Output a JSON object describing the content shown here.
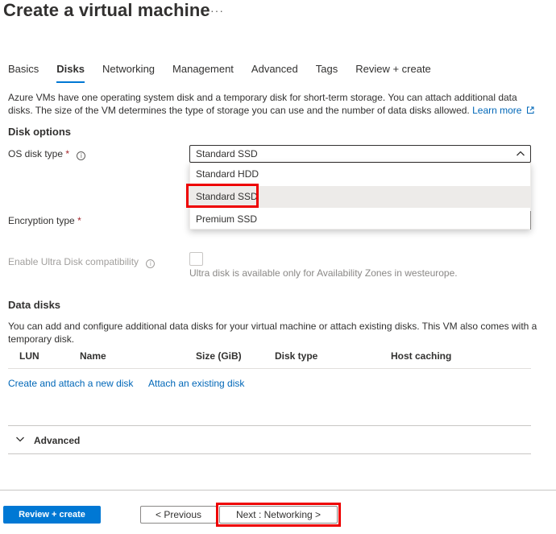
{
  "header": {
    "title": "Create a virtual machine",
    "more": "···"
  },
  "tabs": [
    {
      "label": "Basics"
    },
    {
      "label": "Disks",
      "active": true
    },
    {
      "label": "Networking"
    },
    {
      "label": "Management"
    },
    {
      "label": "Advanced"
    },
    {
      "label": "Tags"
    },
    {
      "label": "Review + create"
    }
  ],
  "intro": {
    "text": "Azure VMs have one operating system disk and a temporary disk for short-term storage. You can attach additional data disks. The size of the VM determines the type of storage you can use and the number of data disks allowed.",
    "learn_more": "Learn more"
  },
  "disk_options": {
    "heading": "Disk options",
    "os_disk_type": {
      "label": "OS disk type",
      "required": "*",
      "info": "i",
      "selected": "Standard SSD",
      "options": [
        "Standard HDD",
        "Standard SSD",
        "Premium SSD"
      ],
      "hovered_option": "Standard SSD"
    },
    "encryption_type": {
      "label": "Encryption type",
      "required": "*"
    },
    "ultra_disk": {
      "label": "Enable Ultra Disk compatibility",
      "info": "i",
      "note": "Ultra disk is available only for Availability Zones in westeurope.",
      "checked": false
    }
  },
  "data_disks": {
    "heading": "Data disks",
    "description": "You can add and configure additional data disks for your virtual machine or attach existing disks. This VM also comes with a temporary disk.",
    "columns": [
      "LUN",
      "Name",
      "Size (GiB)",
      "Disk type",
      "Host caching"
    ],
    "create_link": "Create and attach a new disk",
    "attach_link": "Attach an existing disk"
  },
  "advanced_section": {
    "label": "Advanced"
  },
  "footer": {
    "review_create": "Review + create",
    "previous": "< Previous",
    "next": "Next : Networking >"
  },
  "colors": {
    "accent": "#0078d4",
    "link": "#0067b8",
    "highlight": "#ee0000",
    "required": "#a4262c"
  }
}
